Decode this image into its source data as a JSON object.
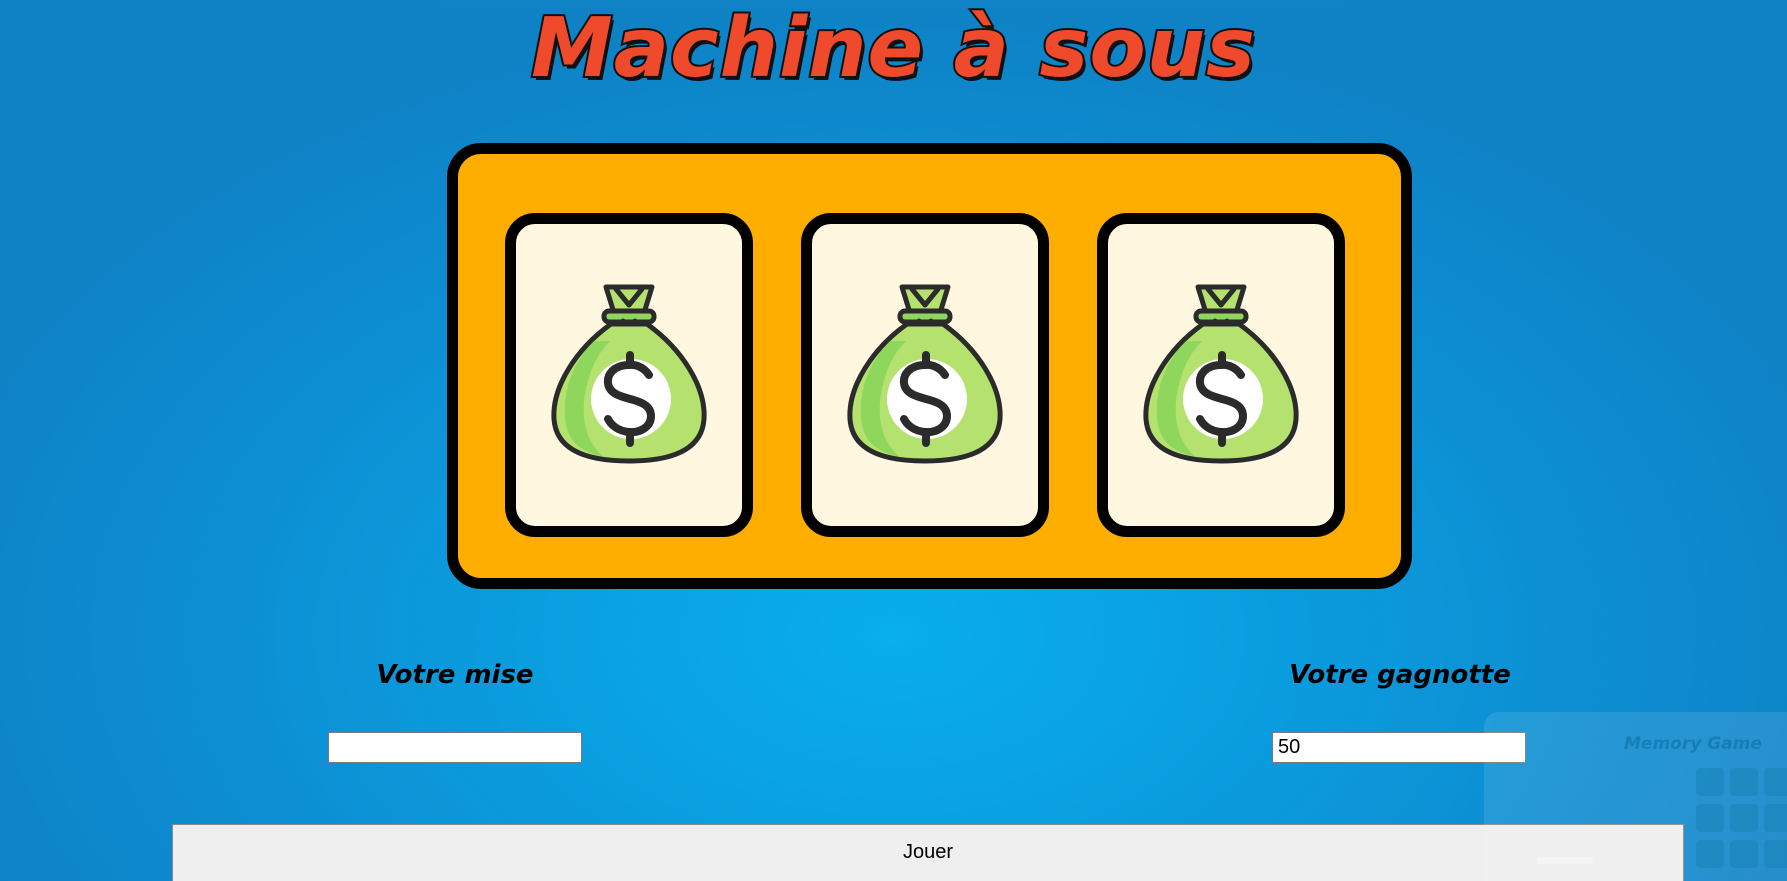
{
  "title": "Machine à sous",
  "reels": [
    {
      "symbol": "money-bag-icon"
    },
    {
      "symbol": "money-bag-icon"
    },
    {
      "symbol": "money-bag-icon"
    }
  ],
  "bet": {
    "label": "Votre mise",
    "value": ""
  },
  "winnings": {
    "label": "Votre gagnotte",
    "value": "50"
  },
  "play_button": {
    "label": "Jouer"
  },
  "thumbnail": {
    "title": "Memory Game"
  },
  "colors": {
    "background": "#0a9fe0",
    "machine": "#feae00",
    "reel": "#fff7e0",
    "title": "#f04a2c",
    "bag_green": "#b5e26f",
    "bag_shade": "#8fd65c"
  }
}
